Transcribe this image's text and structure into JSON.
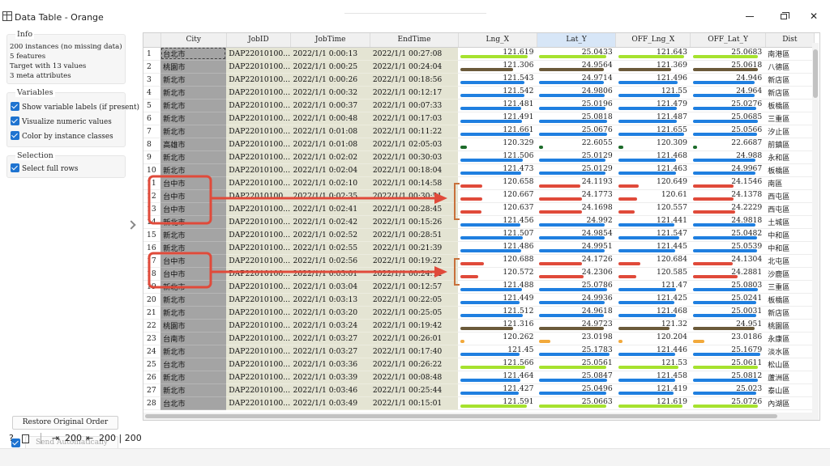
{
  "window": {
    "title": "Data Table - Orange"
  },
  "info": {
    "legend": "Info",
    "lines": [
      "200 instances (no missing data)",
      "5 features",
      "Target with 13 values",
      "3 meta attributes"
    ]
  },
  "variables": {
    "legend": "Variables",
    "show_labels": "Show variable labels (if present)",
    "visualize_numeric": "Visualize numeric values",
    "color_by_class": "Color by instance classes"
  },
  "selection": {
    "legend": "Selection",
    "select_full_rows": "Select full rows"
  },
  "buttons": {
    "restore": "Restore Original Order",
    "send": "Send Automatically"
  },
  "status": {
    "input_count": "200",
    "output_count": "200 | 200"
  },
  "table": {
    "headers": [
      "City",
      "JobID",
      "JobTime",
      "EndTime",
      "Lng_X",
      "Lat_Y",
      "OFF_Lng_X",
      "OFF_Lat_Y",
      "Dist"
    ],
    "rows": [
      {
        "idx": "1",
        "city": "台北市",
        "job": "DAP22010100...",
        "time": "2022/1/1 0:00:13",
        "end": "2022/1/1 00:27:08",
        "lng": "121.619",
        "lat": "25.0433",
        "olng": "121.643",
        "olat": "25.0683",
        "dist": "南港區",
        "color": "#a6e22e"
      },
      {
        "idx": "2",
        "city": "桃園市",
        "job": "DAP22010100...",
        "time": "2022/1/1 0:00:25",
        "end": "2022/1/1 00:24:04",
        "lng": "121.306",
        "lat": "24.9564",
        "olng": "121.369",
        "olat": "25.0618",
        "dist": "八德區",
        "color": "#6b5a3a"
      },
      {
        "idx": "3",
        "city": "新北市",
        "job": "DAP22010100...",
        "time": "2022/1/1 0:00:26",
        "end": "2022/1/1 00:18:56",
        "lng": "121.543",
        "lat": "24.9714",
        "olng": "121.496",
        "olat": "24.946",
        "dist": "新店區",
        "color": "#1f7fe0"
      },
      {
        "idx": "4",
        "city": "新北市",
        "job": "DAP22010100...",
        "time": "2022/1/1 0:00:32",
        "end": "2022/1/1 00:12:17",
        "lng": "121.542",
        "lat": "24.9806",
        "olng": "121.55",
        "olat": "24.964",
        "dist": "新店區",
        "color": "#1f7fe0"
      },
      {
        "idx": "5",
        "city": "新北市",
        "job": "DAP22010100...",
        "time": "2022/1/1 0:00:37",
        "end": "2022/1/1 00:07:33",
        "lng": "121.481",
        "lat": "25.0196",
        "olng": "121.479",
        "olat": "25.0276",
        "dist": "板橋區",
        "color": "#1f7fe0"
      },
      {
        "idx": "6",
        "city": "新北市",
        "job": "DAP22010100...",
        "time": "2022/1/1 0:00:48",
        "end": "2022/1/1 00:17:03",
        "lng": "121.491",
        "lat": "25.0818",
        "olng": "121.487",
        "olat": "25.0685",
        "dist": "三重區",
        "color": "#1f7fe0"
      },
      {
        "idx": "7",
        "city": "新北市",
        "job": "DAP22010100...",
        "time": "2022/1/1 0:01:08",
        "end": "2022/1/1 00:11:22",
        "lng": "121.661",
        "lat": "25.0676",
        "olng": "121.655",
        "olat": "25.0566",
        "dist": "汐止區",
        "color": "#1f7fe0"
      },
      {
        "idx": "8",
        "city": "高雄市",
        "job": "DAP22010100...",
        "time": "2022/1/1 0:01:08",
        "end": "2022/1/1 02:05:03",
        "lng": "120.329",
        "lat": "22.6055",
        "olng": "120.309",
        "olat": "22.6687",
        "dist": "前鎮區",
        "color": "#1c6b2a"
      },
      {
        "idx": "9",
        "city": "新北市",
        "job": "DAP22010100...",
        "time": "2022/1/1 0:02:02",
        "end": "2022/1/1 00:30:03",
        "lng": "121.506",
        "lat": "25.0129",
        "olng": "121.468",
        "olat": "24.988",
        "dist": "永和區",
        "color": "#1f7fe0"
      },
      {
        "idx": "10",
        "city": "新北市",
        "job": "DAP22010100...",
        "time": "2022/1/1 0:02:04",
        "end": "2022/1/1 00:18:04",
        "lng": "121.473",
        "lat": "25.0129",
        "olng": "121.463",
        "olat": "24.9967",
        "dist": "板橋區",
        "color": "#1f7fe0"
      },
      {
        "idx": "11",
        "city": "台中市",
        "job": "DAP22010100...",
        "time": "2022/1/1 0:02:10",
        "end": "2022/1/1 00:14:58",
        "lng": "120.658",
        "lat": "24.1193",
        "olng": "120.649",
        "olat": "24.1546",
        "dist": "南區",
        "color": "#e04a3a"
      },
      {
        "idx": "12",
        "city": "台中市",
        "job": "DAP22010100...",
        "time": "2022/1/1 0:02:35",
        "end": "2022/1/1 00:30:51",
        "lng": "120.667",
        "lat": "24.1773",
        "olng": "120.61",
        "olat": "24.1378",
        "dist": "西屯區",
        "color": "#e04a3a"
      },
      {
        "idx": "13",
        "city": "台中市",
        "job": "DAP22010100...",
        "time": "2022/1/1 0:02:41",
        "end": "2022/1/1 00:28:45",
        "lng": "120.637",
        "lat": "24.1698",
        "olng": "120.557",
        "olat": "24.2229",
        "dist": "西屯區",
        "color": "#e04a3a"
      },
      {
        "idx": "14",
        "city": "新北市",
        "job": "DAP22010100...",
        "time": "2022/1/1 0:02:42",
        "end": "2022/1/1 00:15:26",
        "lng": "121.456",
        "lat": "24.992",
        "olng": "121.441",
        "olat": "24.9818",
        "dist": "土城區",
        "color": "#1f7fe0"
      },
      {
        "idx": "15",
        "city": "新北市",
        "job": "DAP22010100...",
        "time": "2022/1/1 0:02:52",
        "end": "2022/1/1 00:28:51",
        "lng": "121.507",
        "lat": "24.9854",
        "olng": "121.547",
        "olat": "25.0482",
        "dist": "中和區",
        "color": "#1f7fe0"
      },
      {
        "idx": "16",
        "city": "新北市",
        "job": "DAP22010100...",
        "time": "2022/1/1 0:02:55",
        "end": "2022/1/1 00:21:39",
        "lng": "121.486",
        "lat": "24.9951",
        "olng": "121.445",
        "olat": "25.0539",
        "dist": "中和區",
        "color": "#1f7fe0"
      },
      {
        "idx": "17",
        "city": "台中市",
        "job": "DAP22010100...",
        "time": "2022/1/1 0:02:56",
        "end": "2022/1/1 00:19:22",
        "lng": "120.688",
        "lat": "24.1726",
        "olng": "120.684",
        "olat": "24.1304",
        "dist": "北屯區",
        "color": "#e04a3a"
      },
      {
        "idx": "18",
        "city": "台中市",
        "job": "DAP22010100...",
        "time": "2022/1/1 0:03:01",
        "end": "2022/1/1 00:24:14",
        "lng": "120.572",
        "lat": "24.2306",
        "olng": "120.585",
        "olat": "24.2881",
        "dist": "沙鹿區",
        "color": "#e04a3a"
      },
      {
        "idx": "19",
        "city": "新北市",
        "job": "DAP22010100...",
        "time": "2022/1/1 0:03:04",
        "end": "2022/1/1 00:12:57",
        "lng": "121.488",
        "lat": "25.0786",
        "olng": "121.47",
        "olat": "25.0803",
        "dist": "三重區",
        "color": "#1f7fe0"
      },
      {
        "idx": "20",
        "city": "新北市",
        "job": "DAP22010100...",
        "time": "2022/1/1 0:03:13",
        "end": "2022/1/1 00:22:05",
        "lng": "121.449",
        "lat": "24.9936",
        "olng": "121.425",
        "olat": "25.0241",
        "dist": "板橋區",
        "color": "#1f7fe0"
      },
      {
        "idx": "21",
        "city": "新北市",
        "job": "DAP22010100...",
        "time": "2022/1/1 0:03:20",
        "end": "2022/1/1 00:25:05",
        "lng": "121.512",
        "lat": "24.9618",
        "olng": "121.468",
        "olat": "25.0031",
        "dist": "新店區",
        "color": "#1f7fe0"
      },
      {
        "idx": "22",
        "city": "桃園市",
        "job": "DAP22010100...",
        "time": "2022/1/1 0:03:24",
        "end": "2022/1/1 00:19:42",
        "lng": "121.316",
        "lat": "24.9723",
        "olng": "121.32",
        "olat": "24.951",
        "dist": "桃園區",
        "color": "#6b5a3a"
      },
      {
        "idx": "23",
        "city": "台南市",
        "job": "DAP22010100...",
        "time": "2022/1/1 0:03:27",
        "end": "2022/1/1 00:26:01",
        "lng": "120.262",
        "lat": "23.0198",
        "olng": "120.204",
        "olat": "23.0186",
        "dist": "永康區",
        "color": "#f2a93b"
      },
      {
        "idx": "24",
        "city": "新北市",
        "job": "DAP22010100...",
        "time": "2022/1/1 0:03:27",
        "end": "2022/1/1 00:17:40",
        "lng": "121.45",
        "lat": "25.1783",
        "olng": "121.446",
        "olat": "25.1679",
        "dist": "淡水區",
        "color": "#1f7fe0"
      },
      {
        "idx": "25",
        "city": "台北市",
        "job": "DAP22010100...",
        "time": "2022/1/1 0:03:36",
        "end": "2022/1/1 00:26:22",
        "lng": "121.566",
        "lat": "25.0561",
        "olng": "121.53",
        "olat": "25.0611",
        "dist": "松山區",
        "color": "#a6e22e"
      },
      {
        "idx": "26",
        "city": "新北市",
        "job": "DAP22010100...",
        "time": "2022/1/1 0:03:39",
        "end": "2022/1/1 00:08:48",
        "lng": "121.464",
        "lat": "25.0847",
        "olng": "121.458",
        "olat": "25.0812",
        "dist": "蘆洲區",
        "color": "#1f7fe0"
      },
      {
        "idx": "27",
        "city": "新北市",
        "job": "DAP22010100...",
        "time": "2022/1/1 0:03:46",
        "end": "2022/1/1 00:25:44",
        "lng": "121.427",
        "lat": "25.0496",
        "olng": "121.419",
        "olat": "25.023",
        "dist": "泰山區",
        "color": "#1f7fe0"
      },
      {
        "idx": "28",
        "city": "台北市",
        "job": "DAP22010100...",
        "time": "2022/1/1 0:03:49",
        "end": "2022/1/1 00:15:01",
        "lng": "121.591",
        "lat": "25.0663",
        "olng": "121.619",
        "olat": "25.0726",
        "dist": "內湖區",
        "color": "#a6e22e"
      }
    ]
  },
  "annotation_color": "#e04a3a"
}
